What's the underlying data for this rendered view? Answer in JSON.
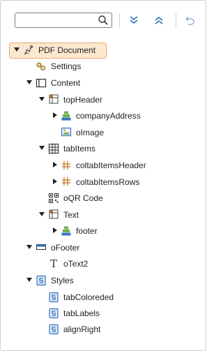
{
  "search": {
    "value": "",
    "placeholder": ""
  },
  "toolbar": {
    "search_icon": "search-icon",
    "expand_all_icon": "expand-all-icon",
    "collapse_all_icon": "collapse-all-icon",
    "undo_icon": "undo-icon"
  },
  "colors": {
    "selected_bg": "#fce8cf",
    "selected_border": "#e8a86a",
    "icon_blue": "#3a72c0",
    "icon_green": "#6cb04a",
    "icon_orange": "#c87a22"
  },
  "tree": {
    "root": "PDF Document",
    "settings": "Settings",
    "content": "Content",
    "topHeader": "topHeader",
    "companyAddress": "companyAddress",
    "oImage": "oImage",
    "tabItems": "tabItems",
    "coltabItemsHeader": "coltabItemsHeader",
    "coltabItemsRows": "coltabItemsRows",
    "oQRCode": "oQR Code",
    "text": "Text",
    "footer": "footer",
    "oFooter": "oFooter",
    "oText2": "oText2",
    "styles": "Styles",
    "tabColoreded": "tabColoreded",
    "tabLabels": "tabLabels",
    "alignRight": "alignRight"
  }
}
